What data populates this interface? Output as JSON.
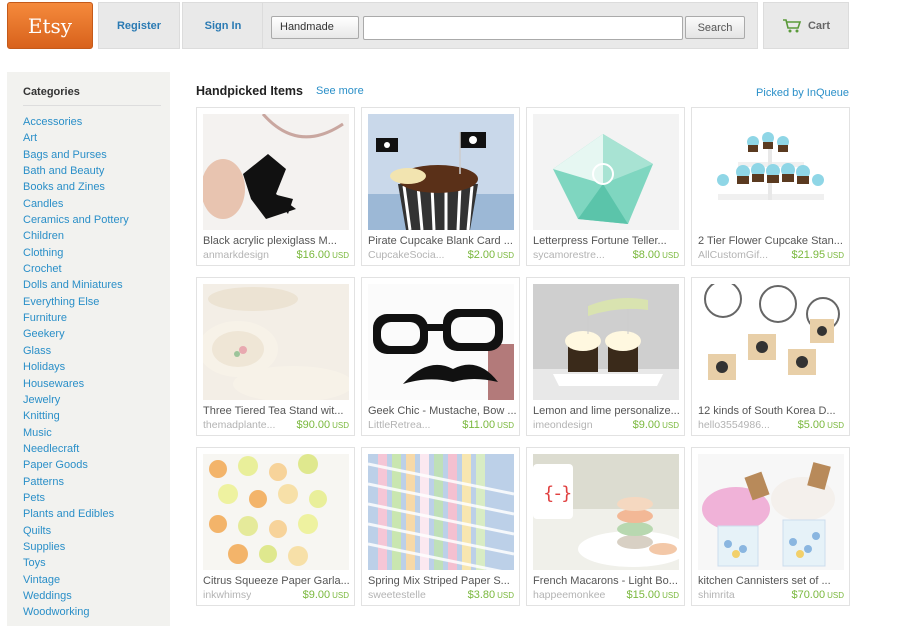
{
  "header": {
    "logo": "Etsy",
    "register_label": "Register",
    "signin_label": "Sign In",
    "search_category": "Handmade",
    "search_value": "",
    "search_button": "Search",
    "cart_label": "Cart"
  },
  "sidebar": {
    "title": "Categories",
    "items": [
      "Accessories",
      "Art",
      "Bags and Purses",
      "Bath and Beauty",
      "Books and Zines",
      "Candles",
      "Ceramics and Pottery",
      "Children",
      "Clothing",
      "Crochet",
      "Dolls and Miniatures",
      "Everything Else",
      "Furniture",
      "Geekery",
      "Glass",
      "Holidays",
      "Housewares",
      "Jewelry",
      "Knitting",
      "Music",
      "Needlecraft",
      "Paper Goods",
      "Patterns",
      "Pets",
      "Plants and Edibles",
      "Quilts",
      "Supplies",
      "Toys",
      "Vintage",
      "Weddings",
      "Woodworking"
    ]
  },
  "main": {
    "title": "Handpicked Items",
    "see_more": "See more",
    "picked_by": "Picked by InQueue",
    "currency": "USD",
    "items": [
      {
        "title": "Black acrylic plexiglass M...",
        "shop": "anmarkdesign",
        "price": "$16.00",
        "thumb": "pendant"
      },
      {
        "title": "Pirate Cupcake Blank Card ...",
        "shop": "CupcakeSocia...",
        "price": "$2.00",
        "thumb": "pirate-cupcake"
      },
      {
        "title": "Letterpress Fortune Teller...",
        "shop": "sycamorestre...",
        "price": "$8.00",
        "thumb": "fortune-teller"
      },
      {
        "title": "2 Tier Flower Cupcake Stan...",
        "shop": "AllCustomGif...",
        "price": "$21.95",
        "thumb": "cupcake-stand"
      },
      {
        "title": "Three Tiered Tea Stand wit...",
        "shop": "themadplante...",
        "price": "$90.00",
        "thumb": "tea-stand"
      },
      {
        "title": "Geek Chic - Mustache, Bow ...",
        "shop": "LittleRetrea...",
        "price": "$11.00",
        "thumb": "glasses-mustache"
      },
      {
        "title": "Lemon and lime personalize...",
        "shop": "imeondesign",
        "price": "$9.00",
        "thumb": "lemon-cupcakes"
      },
      {
        "title": "12 kinds of South Korea D...",
        "shop": "hello3554986...",
        "price": "$5.00",
        "thumb": "stamps"
      },
      {
        "title": "Citrus Squeeze Paper Garla...",
        "shop": "inkwhimsy",
        "price": "$9.00",
        "thumb": "garland"
      },
      {
        "title": "Spring Mix Striped Paper S...",
        "shop": "sweetestelle",
        "price": "$3.80",
        "thumb": "straws"
      },
      {
        "title": "French Macarons - Light Bo...",
        "shop": "happeemonkee",
        "price": "$15.00",
        "thumb": "macarons"
      },
      {
        "title": "kitchen Cannisters set of ...",
        "shop": "shimrita",
        "price": "$70.00",
        "thumb": "cannisters"
      }
    ]
  }
}
